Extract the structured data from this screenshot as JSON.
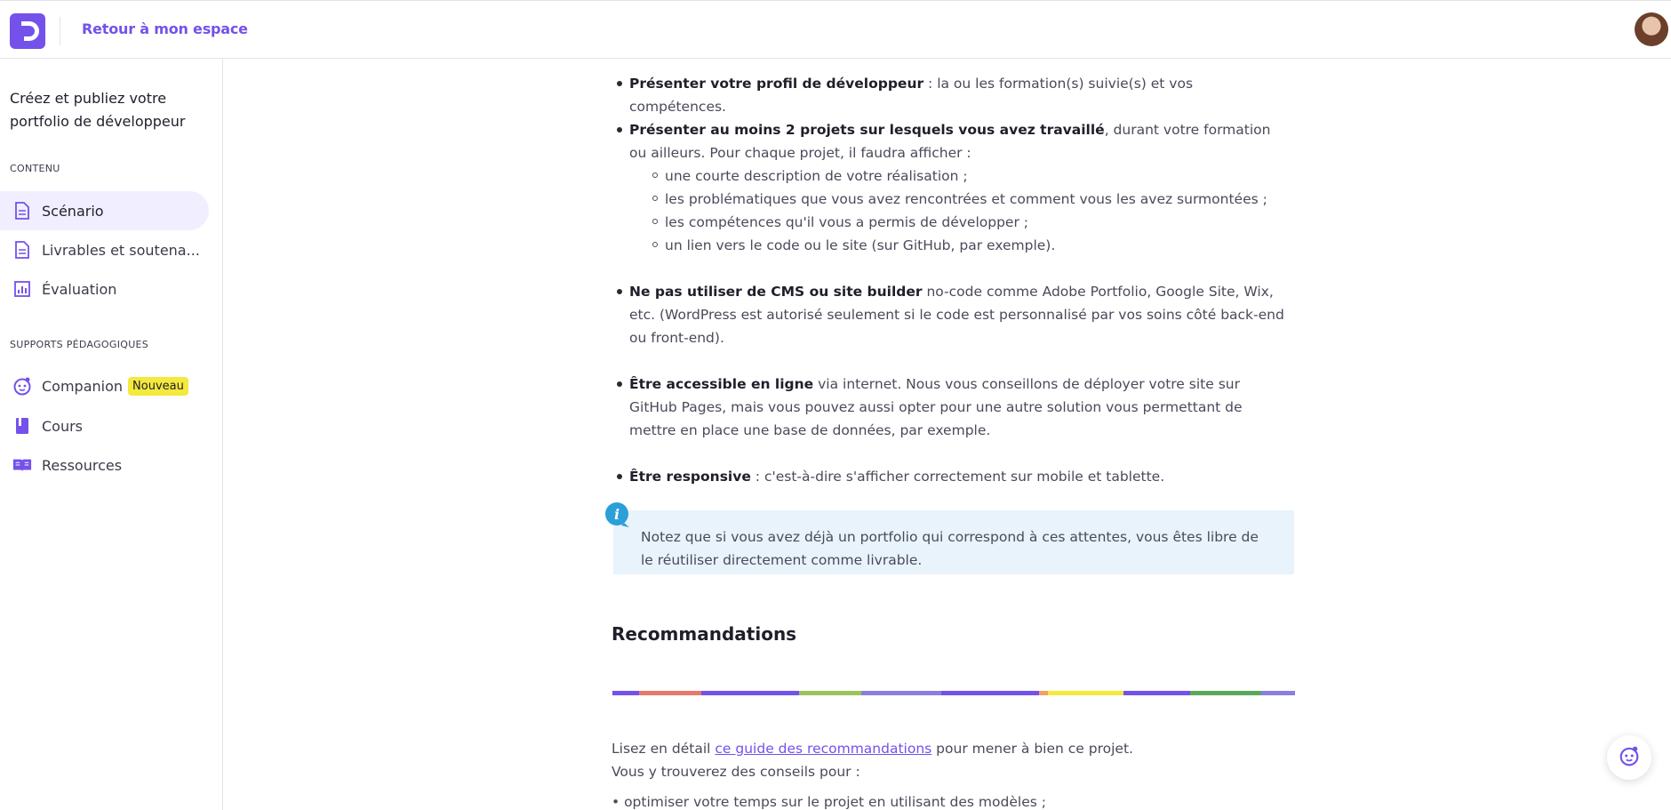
{
  "header": {
    "back_label": "Retour à mon espace"
  },
  "sidebar": {
    "title": "Créez et publiez votre portfolio de développeur",
    "sections": [
      {
        "label": "CONTENU"
      },
      {
        "label": "SUPPORTS PÉDAGOGIQUES"
      }
    ],
    "content_items": [
      {
        "label": "Scénario",
        "icon": "document-icon",
        "active": true
      },
      {
        "label": "Livrables et soutena...",
        "icon": "document-icon"
      },
      {
        "label": "Évaluation",
        "icon": "bar-chart-icon"
      }
    ],
    "support_items": [
      {
        "label": "Companion",
        "icon": "companion-icon",
        "badge": "Nouveau"
      },
      {
        "label": "Cours",
        "icon": "book-icon"
      },
      {
        "label": "Ressources",
        "icon": "open-book-icon"
      }
    ]
  },
  "main": {
    "bullets": [
      {
        "bold": "Présenter votre profil de développeur",
        "text": " : la ou les formation(s) suivie(s) et vos compétences."
      },
      {
        "bold": "Présenter au moins 2 projets sur lesquels vous avez travaillé",
        "text": ", durant votre formation ou ailleurs. Pour chaque projet, il faudra afficher :"
      },
      {
        "bold": "Ne pas utiliser de CMS ou site builder",
        "text": " no-code comme Adobe Portfolio, Google Site, Wix, etc. (WordPress est autorisé seulement si le code est personnalisé par vos soins côté back-end ou front-end)."
      },
      {
        "bold": "Être accessible en ligne",
        "text": " via internet. Nous vous conseillons de déployer votre site sur GitHub Pages, mais vous pouvez aussi opter pour une autre solution vous permettant de mettre en place une base de données, par exemple."
      },
      {
        "bold": "Être responsive",
        "text": " : c'est-à-dire s'afficher correctement sur mobile et tablette."
      }
    ],
    "sub_bullets": [
      "une courte description de votre réalisation ;",
      "les problématiques que vous avez rencontrées et comment vous les avez surmontées ;",
      "les compétences qu'il vous a permis de développer ;",
      "un lien vers le code ou le site (sur GitHub, par exemple)."
    ],
    "note": "Notez que si vous avez déjà un portfolio qui correspond à ces attentes, vous êtes libre de le réutiliser directement comme livrable.",
    "heading": "Recommandations",
    "para1_before": "Lisez en détail ",
    "para1_link": "ce guide des recommandations",
    "para1_after": " pour mener à bien ce projet.",
    "para2": "Vous y trouverez des conseils pour :",
    "para3": "• optimiser votre temps sur le projet en utilisant des modèles ;"
  },
  "colors": {
    "accent": "#7451eb",
    "badge": "#f4e93d",
    "note_bg": "#e8f3fb",
    "info": "#2a9fd8"
  }
}
